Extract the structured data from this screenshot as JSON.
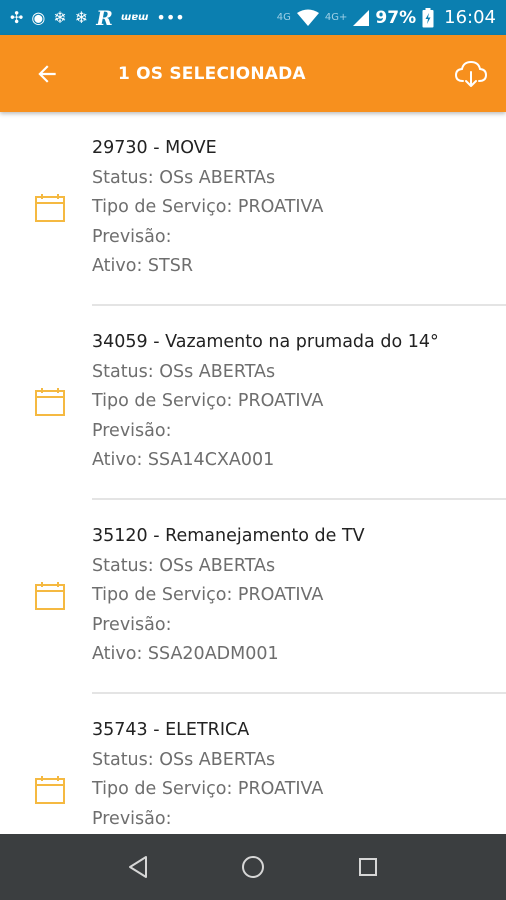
{
  "statusbar": {
    "network_label": "4G",
    "secondary_network": "4G+",
    "battery": "97%",
    "time": "16:04"
  },
  "appbar": {
    "title": "1 OS SELECIONADA"
  },
  "orders": [
    {
      "title": "29730 - MOVE",
      "status": "Status: OSs ABERTAs",
      "service_type": "Tipo de Serviço: PROATIVA",
      "forecast": "Previsão:",
      "asset": "Ativo: STSR"
    },
    {
      "title": "34059 - Vazamento na prumada do 14°",
      "status": "Status: OSs ABERTAs",
      "service_type": "Tipo de Serviço: PROATIVA",
      "forecast": "Previsão:",
      "asset": "Ativo: SSA14CXA001"
    },
    {
      "title": "35120 - Remanejamento de TV",
      "status": "Status: OSs ABERTAs",
      "service_type": "Tipo de Serviço: PROATIVA",
      "forecast": "Previsão:",
      "asset": "Ativo: SSA20ADM001"
    },
    {
      "title": "35743 - ELETRICA",
      "status": "Status: OSs ABERTAs",
      "service_type": "Tipo de Serviço: PROATIVA",
      "forecast": "Previsão:",
      "asset": ""
    }
  ],
  "colors": {
    "statusbar": "#0b7fb0",
    "appbar": "#f7901e",
    "calendar_icon": "#f5b941",
    "navbar": "#3b3e40"
  },
  "icons": {
    "back": "arrow-left-icon",
    "download": "cloud-download-icon",
    "item": "calendar-icon",
    "nav_back": "triangle-back-icon",
    "nav_home": "circle-home-icon",
    "nav_recents": "square-recents-icon"
  }
}
